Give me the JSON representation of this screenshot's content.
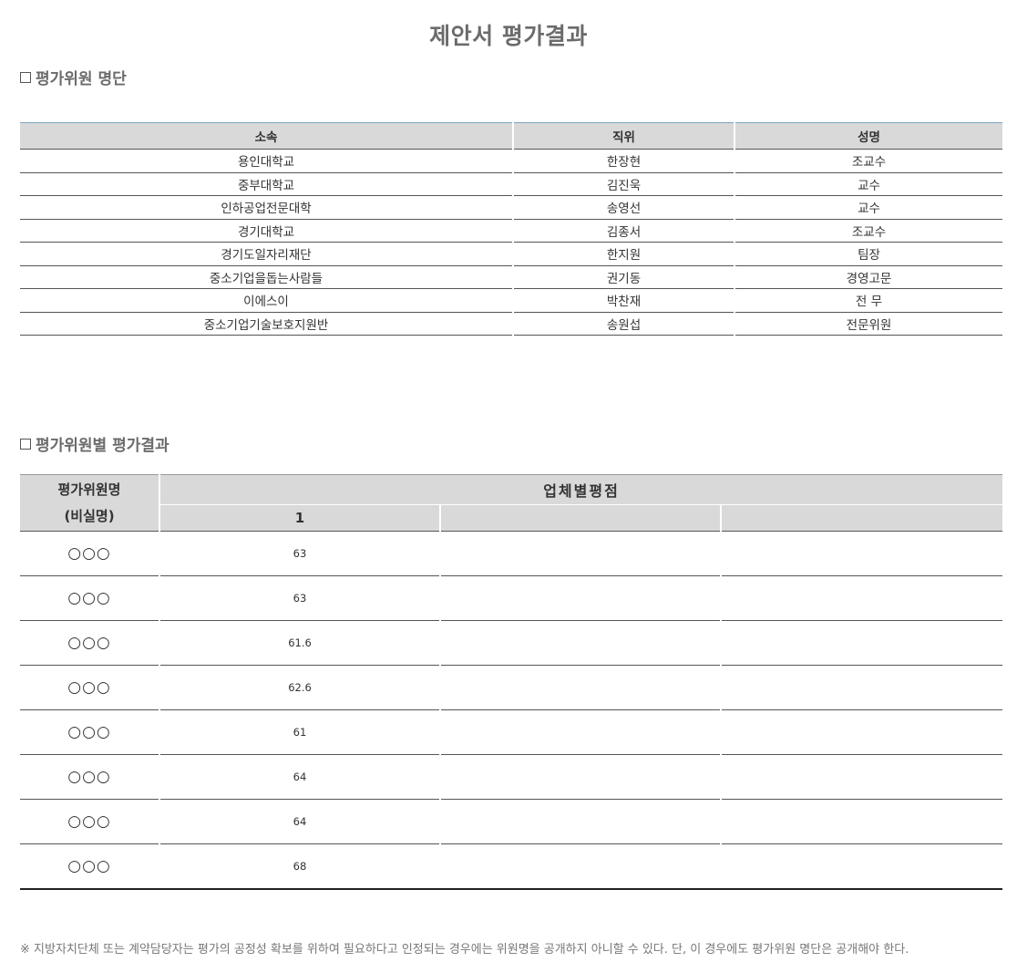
{
  "page": {
    "title": "제안서 평가결과"
  },
  "committee_section": {
    "heading": "평가위원 명단",
    "columns": [
      "소속",
      "직위",
      "성명"
    ],
    "rows": [
      [
        "용인대학교",
        "한장현",
        "조교수"
      ],
      [
        "중부대학교",
        "김진욱",
        "교수"
      ],
      [
        "인하공업전문대학",
        "송영선",
        "교수"
      ],
      [
        "경기대학교",
        "김종서",
        "조교수"
      ],
      [
        "경기도일자리재단",
        "한지원",
        "팀장"
      ],
      [
        "중소기업을돕는사람들",
        "권기동",
        "경영고문"
      ],
      [
        "이에스이",
        "박찬재",
        "전 무"
      ],
      [
        "중소기업기술보호지원반",
        "송원섭",
        "전문위원"
      ]
    ]
  },
  "score_section": {
    "heading": "평가위원별 평가결과",
    "name_header_line1": "평가위원명",
    "name_header_line2": "(비실명)",
    "group_header": "업체별평점",
    "sub_headers": [
      "1",
      "",
      ""
    ],
    "rows": [
      {
        "evaluator": "○○○",
        "scores": [
          "63",
          "",
          ""
        ]
      },
      {
        "evaluator": "○○○",
        "scores": [
          "63",
          "",
          ""
        ]
      },
      {
        "evaluator": "○○○",
        "scores": [
          "61.6",
          "",
          ""
        ]
      },
      {
        "evaluator": "○○○",
        "scores": [
          "62.6",
          "",
          ""
        ]
      },
      {
        "evaluator": "○○○",
        "scores": [
          "61",
          "",
          ""
        ]
      },
      {
        "evaluator": "○○○",
        "scores": [
          "64",
          "",
          ""
        ]
      },
      {
        "evaluator": "○○○",
        "scores": [
          "64",
          "",
          ""
        ]
      },
      {
        "evaluator": "○○○",
        "scores": [
          "68",
          "",
          ""
        ]
      }
    ]
  },
  "footnote": "※ 지방자치단체 또는 계약담당자는 평가의 공정성 확보를 위하여 필요하다고 인정되는 경우에는 위원명을 공개하지 아니할 수 있다. 단, 이 경우에도 평가위원 명단은 공개해야 한다.",
  "colors": {
    "header_bg": "#d9d9d9",
    "heading_text": "#6b6b6b",
    "rule": "#555555"
  }
}
